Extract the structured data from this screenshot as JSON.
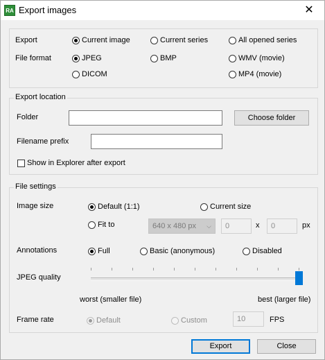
{
  "window": {
    "title": "Export images",
    "app_icon_text": "RA"
  },
  "export_group": {
    "export_label": "Export",
    "export_options": [
      {
        "label": "Current image",
        "selected": true
      },
      {
        "label": "Current series",
        "selected": false
      },
      {
        "label": "All opened series",
        "selected": false
      }
    ],
    "format_label": "File format",
    "format_options": [
      {
        "label": "JPEG",
        "selected": true
      },
      {
        "label": "BMP",
        "selected": false
      },
      {
        "label": "WMV (movie)",
        "selected": false
      },
      {
        "label": "DICOM",
        "selected": false
      },
      {
        "label": "MP4 (movie)",
        "selected": false
      }
    ]
  },
  "location_group": {
    "title": "Export location",
    "folder_label": "Folder",
    "folder_value": "",
    "choose_folder_label": "Choose folder",
    "prefix_label": "Filename prefix",
    "prefix_value": "",
    "show_explorer_label": "Show in Explorer after export",
    "show_explorer_checked": false
  },
  "file_settings": {
    "title": "File settings",
    "image_size_label": "Image size",
    "size_options": [
      {
        "label": "Default (1:1)",
        "selected": true
      },
      {
        "label": "Current size",
        "selected": false
      },
      {
        "label": "Fit to",
        "selected": false
      }
    ],
    "fit_select_value": "640 x 480 px",
    "width_value": "0",
    "times_symbol": "x",
    "height_value": "0",
    "px_unit": "px",
    "annotations_label": "Annotations",
    "annotation_options": [
      {
        "label": "Full",
        "selected": true
      },
      {
        "label": "Basic (anonymous)",
        "selected": false
      },
      {
        "label": "Disabled",
        "selected": false
      }
    ],
    "jpeg_quality_label": "JPEG quality",
    "jpeg_quality_level": 1.0,
    "quality_min_label": "worst (smaller file)",
    "quality_max_label": "best (larger file)",
    "frame_rate_label": "Frame rate",
    "frame_rate_options": [
      {
        "label": "Default",
        "selected": true
      },
      {
        "label": "Custom",
        "selected": false
      }
    ],
    "fps_value": "10",
    "fps_unit": "FPS"
  },
  "footer": {
    "export_label": "Export",
    "close_label": "Close"
  },
  "colors": {
    "accent": "#0078d7",
    "background": "#f0f0f0",
    "app_icon": "#2f8f3a"
  }
}
